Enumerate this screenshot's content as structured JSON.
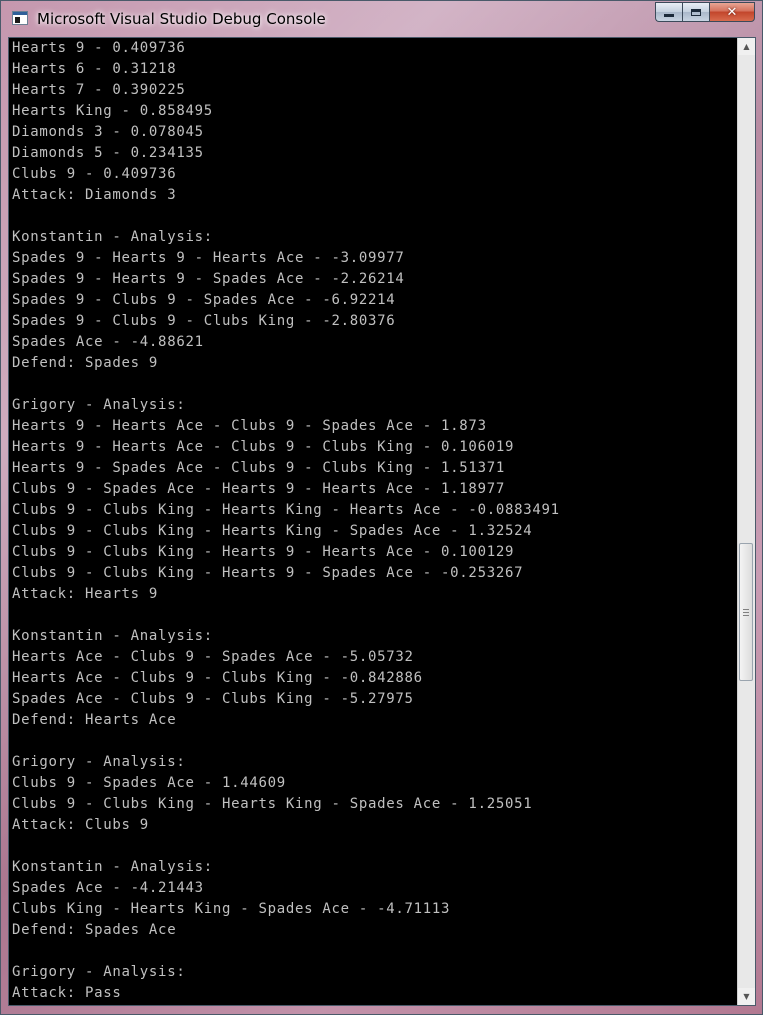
{
  "window": {
    "title": "Microsoft Visual Studio Debug Console",
    "close_glyph": "✕"
  },
  "icons": {
    "app": "console-window-icon",
    "minimize": "minimize-icon",
    "maximize": "maximize-icon",
    "close": "close-icon",
    "scroll_up": "scroll-up-arrow-icon",
    "scroll_down": "scroll-down-arrow-icon"
  },
  "scrollbar": {
    "up_glyph": "▲",
    "down_glyph": "▼"
  },
  "colors": {
    "console_background": "#000000",
    "console_text": "#c0c0c0",
    "close_button": "#c2452b"
  },
  "console": {
    "lines": [
      "Hearts 9 - 0.409736",
      "Hearts 6 - 0.31218",
      "Hearts 7 - 0.390225",
      "Hearts King - 0.858495",
      "Diamonds 3 - 0.078045",
      "Diamonds 5 - 0.234135",
      "Clubs 9 - 0.409736",
      "Attack: Diamonds 3",
      "",
      "Konstantin - Analysis:",
      "Spades 9 - Hearts 9 - Hearts Ace - -3.09977",
      "Spades 9 - Hearts 9 - Spades Ace - -2.26214",
      "Spades 9 - Clubs 9 - Spades Ace - -6.92214",
      "Spades 9 - Clubs 9 - Clubs King - -2.80376",
      "Spades Ace - -4.88621",
      "Defend: Spades 9",
      "",
      "Grigory - Analysis:",
      "Hearts 9 - Hearts Ace - Clubs 9 - Spades Ace - 1.873",
      "Hearts 9 - Hearts Ace - Clubs 9 - Clubs King - 0.106019",
      "Hearts 9 - Spades Ace - Clubs 9 - Clubs King - 1.51371",
      "Clubs 9 - Spades Ace - Hearts 9 - Hearts Ace - 1.18977",
      "Clubs 9 - Clubs King - Hearts King - Hearts Ace - -0.0883491",
      "Clubs 9 - Clubs King - Hearts King - Spades Ace - 1.32524",
      "Clubs 9 - Clubs King - Hearts 9 - Hearts Ace - 0.100129",
      "Clubs 9 - Clubs King - Hearts 9 - Spades Ace - -0.253267",
      "Attack: Hearts 9",
      "",
      "Konstantin - Analysis:",
      "Hearts Ace - Clubs 9 - Spades Ace - -5.05732",
      "Hearts Ace - Clubs 9 - Clubs King - -0.842886",
      "Spades Ace - Clubs 9 - Clubs King - -5.27975",
      "Defend: Hearts Ace",
      "",
      "Grigory - Analysis:",
      "Clubs 9 - Spades Ace - 1.44609",
      "Clubs 9 - Clubs King - Hearts King - Spades Ace - 1.25051",
      "Attack: Clubs 9",
      "",
      "Konstantin - Analysis:",
      "Spades Ace - -4.21443",
      "Clubs King - Hearts King - Spades Ace - -4.71113",
      "Defend: Spades Ace",
      "",
      "Grigory - Analysis:",
      "Attack: Pass"
    ]
  }
}
